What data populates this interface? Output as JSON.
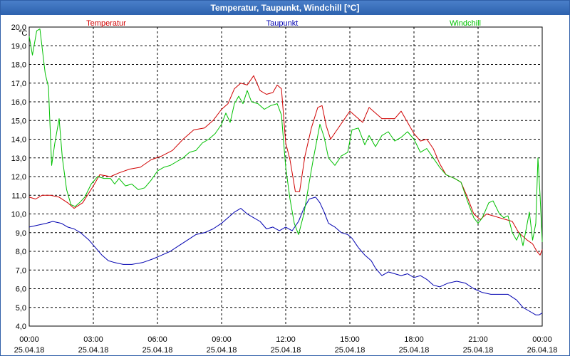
{
  "window": {
    "title": "Temperatur, Taupunkt, Windchill [°C]"
  },
  "chart_data": {
    "type": "line",
    "title": "Temperatur, Taupunkt, Windchill [°C]",
    "ylabel": "°C",
    "xlabel": "",
    "ylim": [
      4.0,
      20.0
    ],
    "yticks": [
      "20,0",
      "19,0",
      "18,0",
      "17,0",
      "16,0",
      "15,0",
      "14,0",
      "13,0",
      "12,0",
      "11,0",
      "10,0",
      "9,0",
      "8,0",
      "7,0",
      "6,0",
      "5,0",
      "4,0"
    ],
    "xlim": [
      0,
      24
    ],
    "xticks": [
      {
        "time": "00:00",
        "date": "25.04.18"
      },
      {
        "time": "03:00",
        "date": "25.04.18"
      },
      {
        "time": "06:00",
        "date": "25.04.18"
      },
      {
        "time": "09:00",
        "date": "25.04.18"
      },
      {
        "time": "12:00",
        "date": "25.04.18"
      },
      {
        "time": "15:00",
        "date": "25.04.18"
      },
      {
        "time": "18:00",
        "date": "25.04.18"
      },
      {
        "time": "21:00",
        "date": "25.04.18"
      },
      {
        "time": "00:00",
        "date": "26.04.18"
      }
    ],
    "grid": true,
    "legend_position": "top",
    "series": [
      {
        "name": "Temperatur",
        "color": "#d00000",
        "points": [
          [
            0,
            10.9
          ],
          [
            0.3,
            10.8
          ],
          [
            0.6,
            11.0
          ],
          [
            1.0,
            11.0
          ],
          [
            1.4,
            10.9
          ],
          [
            1.8,
            10.6
          ],
          [
            2.1,
            10.3
          ],
          [
            2.5,
            10.6
          ],
          [
            3.0,
            11.5
          ],
          [
            3.3,
            12.1
          ],
          [
            3.8,
            12.0
          ],
          [
            4.2,
            12.2
          ],
          [
            4.7,
            12.4
          ],
          [
            5.2,
            12.5
          ],
          [
            5.7,
            12.9
          ],
          [
            6.2,
            13.1
          ],
          [
            6.7,
            13.4
          ],
          [
            7.2,
            14.0
          ],
          [
            7.7,
            14.5
          ],
          [
            8.2,
            14.6
          ],
          [
            8.6,
            15.0
          ],
          [
            9.0,
            15.6
          ],
          [
            9.3,
            15.9
          ],
          [
            9.6,
            16.7
          ],
          [
            9.9,
            17.0
          ],
          [
            10.2,
            16.9
          ],
          [
            10.5,
            17.4
          ],
          [
            10.8,
            16.6
          ],
          [
            11.1,
            16.4
          ],
          [
            11.4,
            16.5
          ],
          [
            11.6,
            16.9
          ],
          [
            11.8,
            16.7
          ],
          [
            12.0,
            13.8
          ],
          [
            12.2,
            12.9
          ],
          [
            12.45,
            11.2
          ],
          [
            12.65,
            11.2
          ],
          [
            12.9,
            13.1
          ],
          [
            13.2,
            14.6
          ],
          [
            13.5,
            15.7
          ],
          [
            13.7,
            15.8
          ],
          [
            13.9,
            14.7
          ],
          [
            14.1,
            14.0
          ],
          [
            14.4,
            14.5
          ],
          [
            14.7,
            15.0
          ],
          [
            15.0,
            15.5
          ],
          [
            15.3,
            15.2
          ],
          [
            15.6,
            14.9
          ],
          [
            15.9,
            15.7
          ],
          [
            16.2,
            15.4
          ],
          [
            16.5,
            15.1
          ],
          [
            16.8,
            15.1
          ],
          [
            17.1,
            15.1
          ],
          [
            17.4,
            15.5
          ],
          [
            17.7,
            14.9
          ],
          [
            18.0,
            14.3
          ],
          [
            18.3,
            13.9
          ],
          [
            18.6,
            14.0
          ],
          [
            18.9,
            13.5
          ],
          [
            19.2,
            12.7
          ],
          [
            19.5,
            12.1
          ],
          [
            19.9,
            11.9
          ],
          [
            20.2,
            11.7
          ],
          [
            20.5,
            10.9
          ],
          [
            20.8,
            10.0
          ],
          [
            21.1,
            9.7
          ],
          [
            21.4,
            10.0
          ],
          [
            21.7,
            9.9
          ],
          [
            22.0,
            9.8
          ],
          [
            22.3,
            9.7
          ],
          [
            22.6,
            9.6
          ],
          [
            22.9,
            9.0
          ],
          [
            23.1,
            8.8
          ],
          [
            23.3,
            8.6
          ],
          [
            23.55,
            8.4
          ],
          [
            23.75,
            8.0
          ],
          [
            23.9,
            7.8
          ],
          [
            24.0,
            8.1
          ]
        ]
      },
      {
        "name": "Taupunkt",
        "color": "#0000b0",
        "points": [
          [
            0,
            9.3
          ],
          [
            0.4,
            9.4
          ],
          [
            0.8,
            9.5
          ],
          [
            1.1,
            9.6
          ],
          [
            1.5,
            9.5
          ],
          [
            1.8,
            9.3
          ],
          [
            2.1,
            9.2
          ],
          [
            2.4,
            9.0
          ],
          [
            2.8,
            8.6
          ],
          [
            3.1,
            8.2
          ],
          [
            3.4,
            7.8
          ],
          [
            3.7,
            7.5
          ],
          [
            4.0,
            7.4
          ],
          [
            4.4,
            7.3
          ],
          [
            4.8,
            7.3
          ],
          [
            5.3,
            7.4
          ],
          [
            5.8,
            7.6
          ],
          [
            6.2,
            7.8
          ],
          [
            6.6,
            8.0
          ],
          [
            7.0,
            8.3
          ],
          [
            7.4,
            8.6
          ],
          [
            7.8,
            8.9
          ],
          [
            8.2,
            9.0
          ],
          [
            8.6,
            9.2
          ],
          [
            9.0,
            9.5
          ],
          [
            9.3,
            9.8
          ],
          [
            9.6,
            10.1
          ],
          [
            9.9,
            10.3
          ],
          [
            10.2,
            10.0
          ],
          [
            10.5,
            9.8
          ],
          [
            10.8,
            9.6
          ],
          [
            11.1,
            9.2
          ],
          [
            11.4,
            9.3
          ],
          [
            11.7,
            9.1
          ],
          [
            12.0,
            9.3
          ],
          [
            12.3,
            9.1
          ],
          [
            12.6,
            9.6
          ],
          [
            12.85,
            10.3
          ],
          [
            13.1,
            10.8
          ],
          [
            13.4,
            10.9
          ],
          [
            13.6,
            10.6
          ],
          [
            13.8,
            10.1
          ],
          [
            14.0,
            9.5
          ],
          [
            14.3,
            9.3
          ],
          [
            14.6,
            9.0
          ],
          [
            14.9,
            8.9
          ],
          [
            15.1,
            8.7
          ],
          [
            15.4,
            8.2
          ],
          [
            15.7,
            7.8
          ],
          [
            16.0,
            7.5
          ],
          [
            16.2,
            7.1
          ],
          [
            16.5,
            6.7
          ],
          [
            16.8,
            6.9
          ],
          [
            17.1,
            6.8
          ],
          [
            17.4,
            6.7
          ],
          [
            17.7,
            6.8
          ],
          [
            18.0,
            6.6
          ],
          [
            18.3,
            6.7
          ],
          [
            18.6,
            6.5
          ],
          [
            18.9,
            6.2
          ],
          [
            19.2,
            6.1
          ],
          [
            19.6,
            6.3
          ],
          [
            20.0,
            6.4
          ],
          [
            20.4,
            6.3
          ],
          [
            20.8,
            6.0
          ],
          [
            21.2,
            5.8
          ],
          [
            21.6,
            5.7
          ],
          [
            22.0,
            5.7
          ],
          [
            22.4,
            5.7
          ],
          [
            22.8,
            5.4
          ],
          [
            23.1,
            5.0
          ],
          [
            23.4,
            4.8
          ],
          [
            23.7,
            4.6
          ],
          [
            23.85,
            4.6
          ],
          [
            24.0,
            4.7
          ]
        ]
      },
      {
        "name": "Windchill",
        "color": "#00c000",
        "points": [
          [
            0,
            19.5
          ],
          [
            0.15,
            18.5
          ],
          [
            0.35,
            19.8
          ],
          [
            0.5,
            19.9
          ],
          [
            0.75,
            17.5
          ],
          [
            0.9,
            16.8
          ],
          [
            1.05,
            12.6
          ],
          [
            1.2,
            13.8
          ],
          [
            1.4,
            15.1
          ],
          [
            1.55,
            13.0
          ],
          [
            1.75,
            11.3
          ],
          [
            1.95,
            10.5
          ],
          [
            2.15,
            10.4
          ],
          [
            2.35,
            10.6
          ],
          [
            2.6,
            10.9
          ],
          [
            2.9,
            11.6
          ],
          [
            3.2,
            12.0
          ],
          [
            3.5,
            11.9
          ],
          [
            3.8,
            11.9
          ],
          [
            4.0,
            11.6
          ],
          [
            4.2,
            11.9
          ],
          [
            4.5,
            11.5
          ],
          [
            4.8,
            11.6
          ],
          [
            5.1,
            11.3
          ],
          [
            5.4,
            11.4
          ],
          [
            5.7,
            11.8
          ],
          [
            6.0,
            12.3
          ],
          [
            6.3,
            12.5
          ],
          [
            6.6,
            12.6
          ],
          [
            6.9,
            12.8
          ],
          [
            7.2,
            13.0
          ],
          [
            7.5,
            13.3
          ],
          [
            7.8,
            13.4
          ],
          [
            8.1,
            13.8
          ],
          [
            8.4,
            14.0
          ],
          [
            8.7,
            14.3
          ],
          [
            9.0,
            14.8
          ],
          [
            9.2,
            15.4
          ],
          [
            9.4,
            14.9
          ],
          [
            9.6,
            15.9
          ],
          [
            9.8,
            16.3
          ],
          [
            10.0,
            15.9
          ],
          [
            10.2,
            16.6
          ],
          [
            10.4,
            16.0
          ],
          [
            10.7,
            15.9
          ],
          [
            11.0,
            15.6
          ],
          [
            11.3,
            15.8
          ],
          [
            11.6,
            15.9
          ],
          [
            11.8,
            15.3
          ],
          [
            12.0,
            12.5
          ],
          [
            12.2,
            10.8
          ],
          [
            12.4,
            9.5
          ],
          [
            12.6,
            8.9
          ],
          [
            12.85,
            10.0
          ],
          [
            13.1,
            11.7
          ],
          [
            13.3,
            13.0
          ],
          [
            13.6,
            14.8
          ],
          [
            13.8,
            14.1
          ],
          [
            14.0,
            13.0
          ],
          [
            14.3,
            12.6
          ],
          [
            14.6,
            13.1
          ],
          [
            14.9,
            13.3
          ],
          [
            15.1,
            14.5
          ],
          [
            15.4,
            14.6
          ],
          [
            15.7,
            13.7
          ],
          [
            15.9,
            14.2
          ],
          [
            16.2,
            13.6
          ],
          [
            16.5,
            14.2
          ],
          [
            16.8,
            14.4
          ],
          [
            17.1,
            13.9
          ],
          [
            17.4,
            14.1
          ],
          [
            17.7,
            14.4
          ],
          [
            18.0,
            14.0
          ],
          [
            18.3,
            13.3
          ],
          [
            18.6,
            13.5
          ],
          [
            18.9,
            13.0
          ],
          [
            19.2,
            12.5
          ],
          [
            19.5,
            12.1
          ],
          [
            19.9,
            11.9
          ],
          [
            20.2,
            11.7
          ],
          [
            20.5,
            10.7
          ],
          [
            20.8,
            9.8
          ],
          [
            21.0,
            9.5
          ],
          [
            21.2,
            9.8
          ],
          [
            21.5,
            10.6
          ],
          [
            21.7,
            10.7
          ],
          [
            22.0,
            10.0
          ],
          [
            22.2,
            9.8
          ],
          [
            22.4,
            9.9
          ],
          [
            22.6,
            9.0
          ],
          [
            22.8,
            8.6
          ],
          [
            22.95,
            9.0
          ],
          [
            23.1,
            8.3
          ],
          [
            23.3,
            9.5
          ],
          [
            23.4,
            10.1
          ],
          [
            23.55,
            8.6
          ],
          [
            23.7,
            9.5
          ],
          [
            23.8,
            13.0
          ],
          [
            23.9,
            11.0
          ],
          [
            24.0,
            8.5
          ]
        ]
      }
    ]
  }
}
